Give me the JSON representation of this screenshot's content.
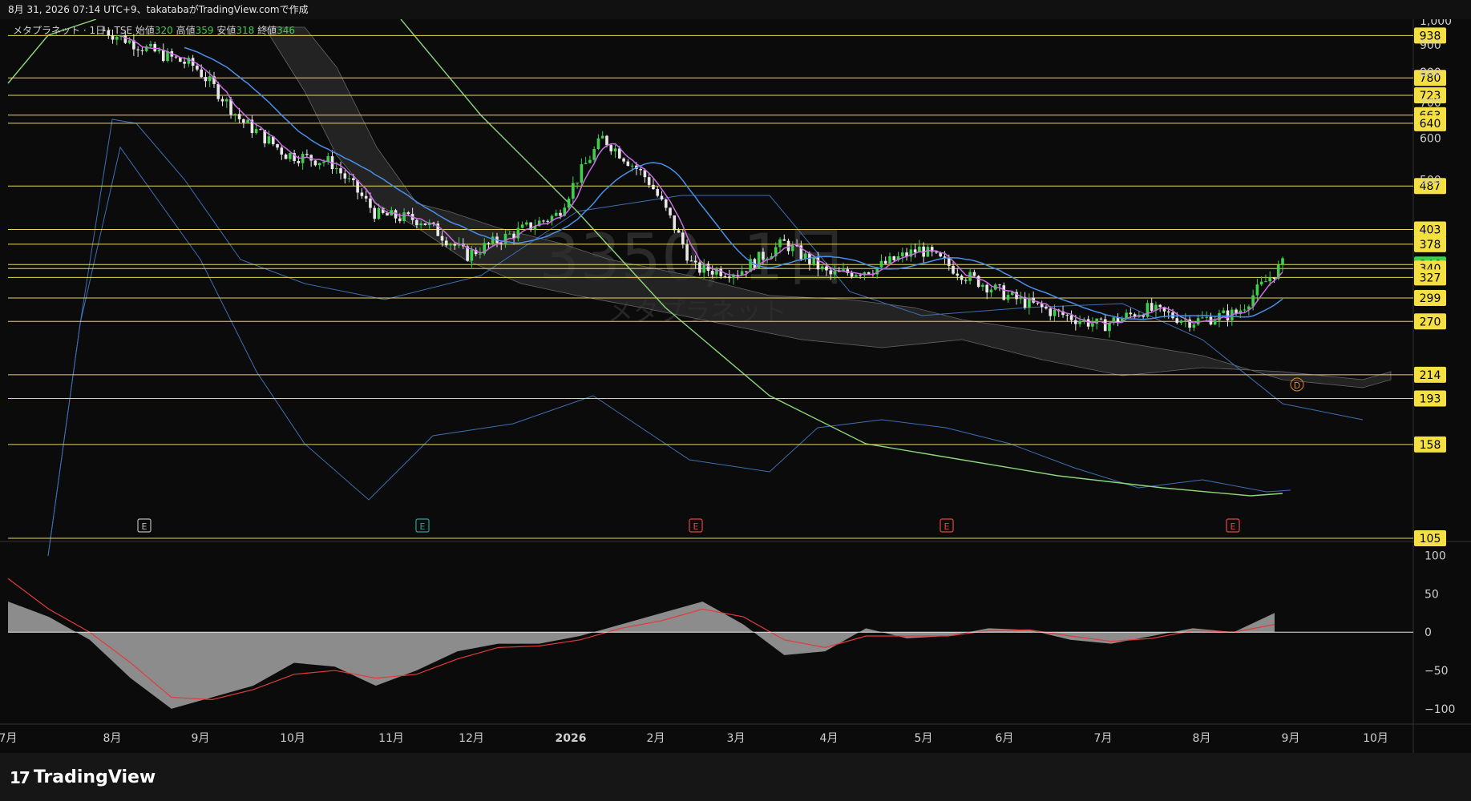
{
  "header": {
    "caption": "8月 31, 2026 07:14 UTC+9、takatabaがTradingView.comで作成"
  },
  "legend": {
    "symbol": "メタプラネット",
    "interval": "1日",
    "exchange": "TSE",
    "open_label": "始値",
    "open": "320",
    "high_label": "高値",
    "high": "359",
    "low_label": "安値",
    "low": "318",
    "close_label": "終値",
    "close": "346"
  },
  "watermark": {
    "line1": "3350, 1日",
    "line2": "メタプラネット"
  },
  "colors": {
    "background": "#0b0b0b",
    "up": "#3ecf4c",
    "down": "#e8e8e8",
    "hline": "#e9d65b",
    "sma_short": "#c86ee0",
    "sma_mid": "#4a8fe8",
    "sma_long": "#8cd67a",
    "bollinger": "#3f6fb5",
    "cloud": "#555555",
    "macd_hist": "#9a9a9a",
    "macd_signal": "#e23b3b",
    "last_price": "#3ecf4c",
    "earnings": "#e04545"
  },
  "chart_data": [
    {
      "type": "candlestick",
      "title": "メタプラネット・1日・TSE",
      "y_scale": "log",
      "ylim": [
        105,
        1000
      ],
      "y_ticks": [
        "1,000",
        "900",
        "800",
        "700",
        "600",
        "500"
      ],
      "x_ticks": [
        "7月",
        "8月",
        "9月",
        "10月",
        "11月",
        "12月",
        "2026",
        "2月",
        "3月",
        "4月",
        "5月",
        "6月",
        "7月",
        "8月",
        "9月",
        "10月"
      ],
      "horizontal_levels": [
        938,
        780,
        723,
        663,
        640,
        487,
        403,
        378,
        346,
        340,
        327,
        299,
        270,
        214,
        193,
        158,
        105
      ],
      "last_price": 346,
      "last_ohlc": {
        "open": 320,
        "high": 359,
        "low": 318,
        "close": 346
      },
      "earnings_markers": [
        "E",
        "E",
        "E",
        "E",
        "E"
      ],
      "dividend_marker": "D",
      "close_approx": {
        "x": [
          "2025-08-01",
          "2025-08-15",
          "2025-09-01",
          "2025-09-15",
          "2025-10-01",
          "2025-10-15",
          "2025-11-01",
          "2025-11-15",
          "2025-12-01",
          "2025-12-15",
          "2026-01-01",
          "2026-01-15",
          "2026-02-01",
          "2026-02-15",
          "2026-03-01",
          "2026-03-15",
          "2026-04-01",
          "2026-04-15",
          "2026-05-01",
          "2026-05-15",
          "2026-06-01",
          "2026-06-15",
          "2026-07-01",
          "2026-07-15",
          "2026-08-01",
          "2026-08-15",
          "2026-08-29"
        ],
        "values": [
          960,
          880,
          820,
          650,
          560,
          540,
          430,
          420,
          360,
          395,
          430,
          600,
          500,
          340,
          335,
          380,
          330,
          340,
          370,
          330,
          300,
          280,
          265,
          285,
          270,
          280,
          346
        ]
      }
    },
    {
      "type": "line",
      "title": "MACD",
      "ylim": [
        -120,
        110
      ],
      "y_ticks": [
        "100",
        "50",
        "0",
        "−50",
        "−100"
      ],
      "series": [
        {
          "values": [
            40,
            20,
            -10,
            -60,
            -100,
            -85,
            -70,
            -40,
            -45,
            -70,
            -50,
            -25,
            -15,
            -15,
            -5,
            10,
            25,
            40,
            10,
            -30,
            -25,
            5,
            -8,
            -5,
            5,
            3,
            -10,
            -15,
            -5,
            5,
            0,
            25
          ]
        },
        {
          "values": [
            70,
            30,
            0,
            -40,
            -85,
            -88,
            -75,
            -55,
            -50,
            -60,
            -55,
            -35,
            -20,
            -18,
            -10,
            5,
            15,
            30,
            20,
            -10,
            -20,
            -5,
            -5,
            -5,
            2,
            3,
            -5,
            -12,
            -8,
            2,
            0,
            10
          ]
        }
      ]
    }
  ],
  "footer": {
    "brand": "TradingView"
  }
}
